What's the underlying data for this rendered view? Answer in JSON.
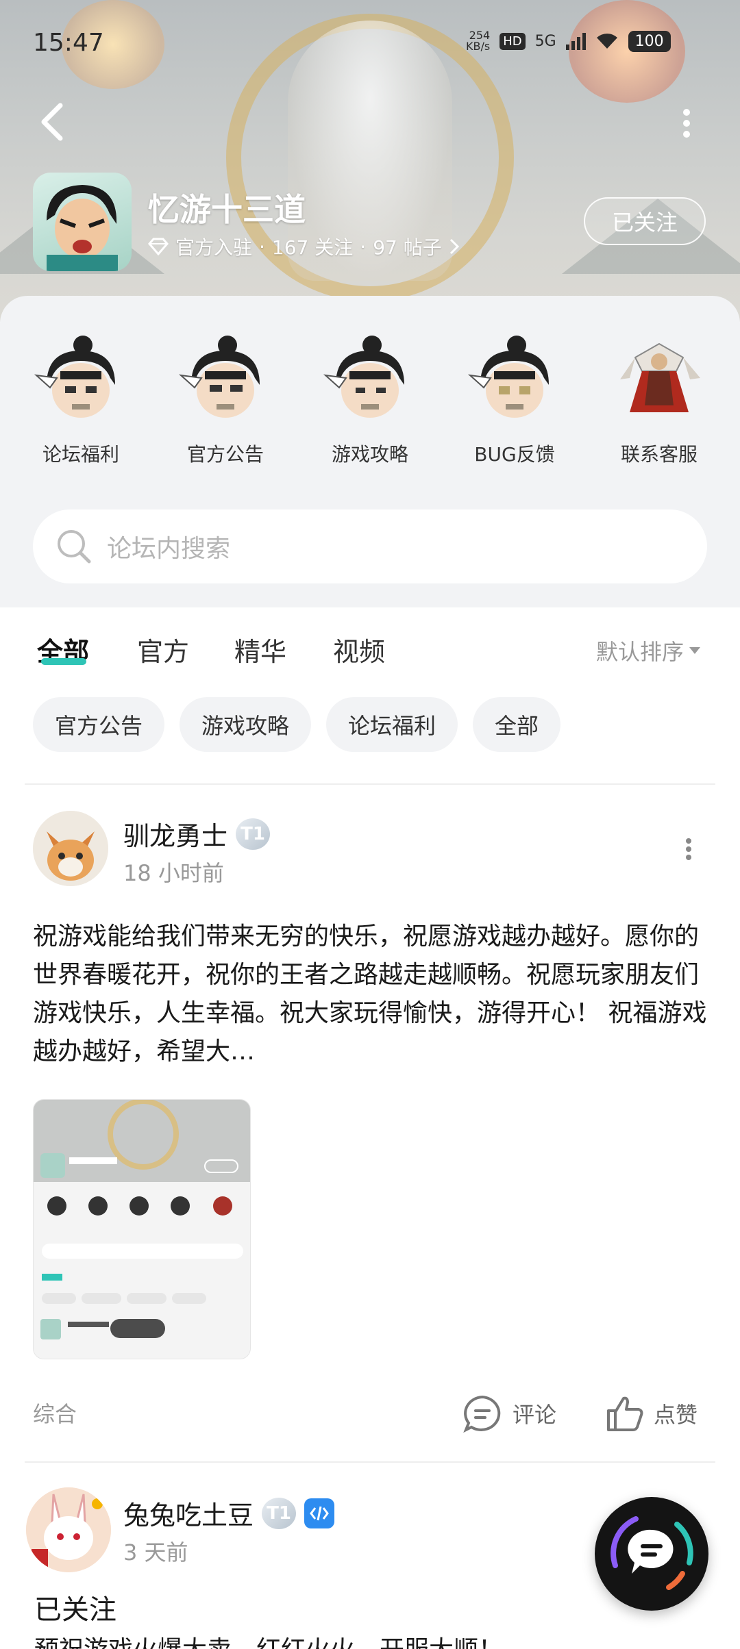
{
  "status_bar": {
    "time": "15:47",
    "net_speed": "254",
    "net_unit": "KB/s",
    "hd": "HD",
    "network": "5G",
    "battery": "100"
  },
  "forum": {
    "name": "忆游十三道",
    "official": "官方入驻",
    "followers": "167 关注",
    "posts": "97 帖子",
    "sep": "·",
    "follow_state": "已关注"
  },
  "categories": [
    {
      "label": "论坛福利",
      "icon": "character-icon"
    },
    {
      "label": "官方公告",
      "icon": "character-icon"
    },
    {
      "label": "游戏攻略",
      "icon": "character-icon"
    },
    {
      "label": "BUG反馈",
      "icon": "character-icon"
    },
    {
      "label": "联系客服",
      "icon": "warrior-icon"
    }
  ],
  "search": {
    "placeholder": "论坛内搜索"
  },
  "tabs": [
    {
      "label": "全部",
      "active": true
    },
    {
      "label": "官方"
    },
    {
      "label": "精华"
    },
    {
      "label": "视频"
    }
  ],
  "sort": {
    "label": "默认排序"
  },
  "chips": [
    "官方公告",
    "游戏攻略",
    "论坛福利",
    "全部"
  ],
  "posts": [
    {
      "author": "驯龙勇士",
      "level": "T1",
      "time": "18 小时前",
      "text": "祝游戏能给我们带来无穷的快乐，祝愿游戏越办越好。愿你的世界春暖花开，祝你的王者之路越走越顺畅。祝愿玩家朋友们游戏快乐，人生幸福。祝大家玩得愉快，游得开心！ 祝福游戏越办越好，希望大…",
      "category": "综合",
      "comment_label": "评论",
      "like_label": "点赞"
    },
    {
      "author": "兔兔吃土豆",
      "level": "T1",
      "time": "3 天前",
      "follow_label": "已关注",
      "partial_text": "预祝游戏火爆大卖，红红火火，开服大顺！"
    }
  ],
  "colors": {
    "accent": "#2ec4b6",
    "chip_bg": "#f2f3f5",
    "muted": "#999999"
  }
}
